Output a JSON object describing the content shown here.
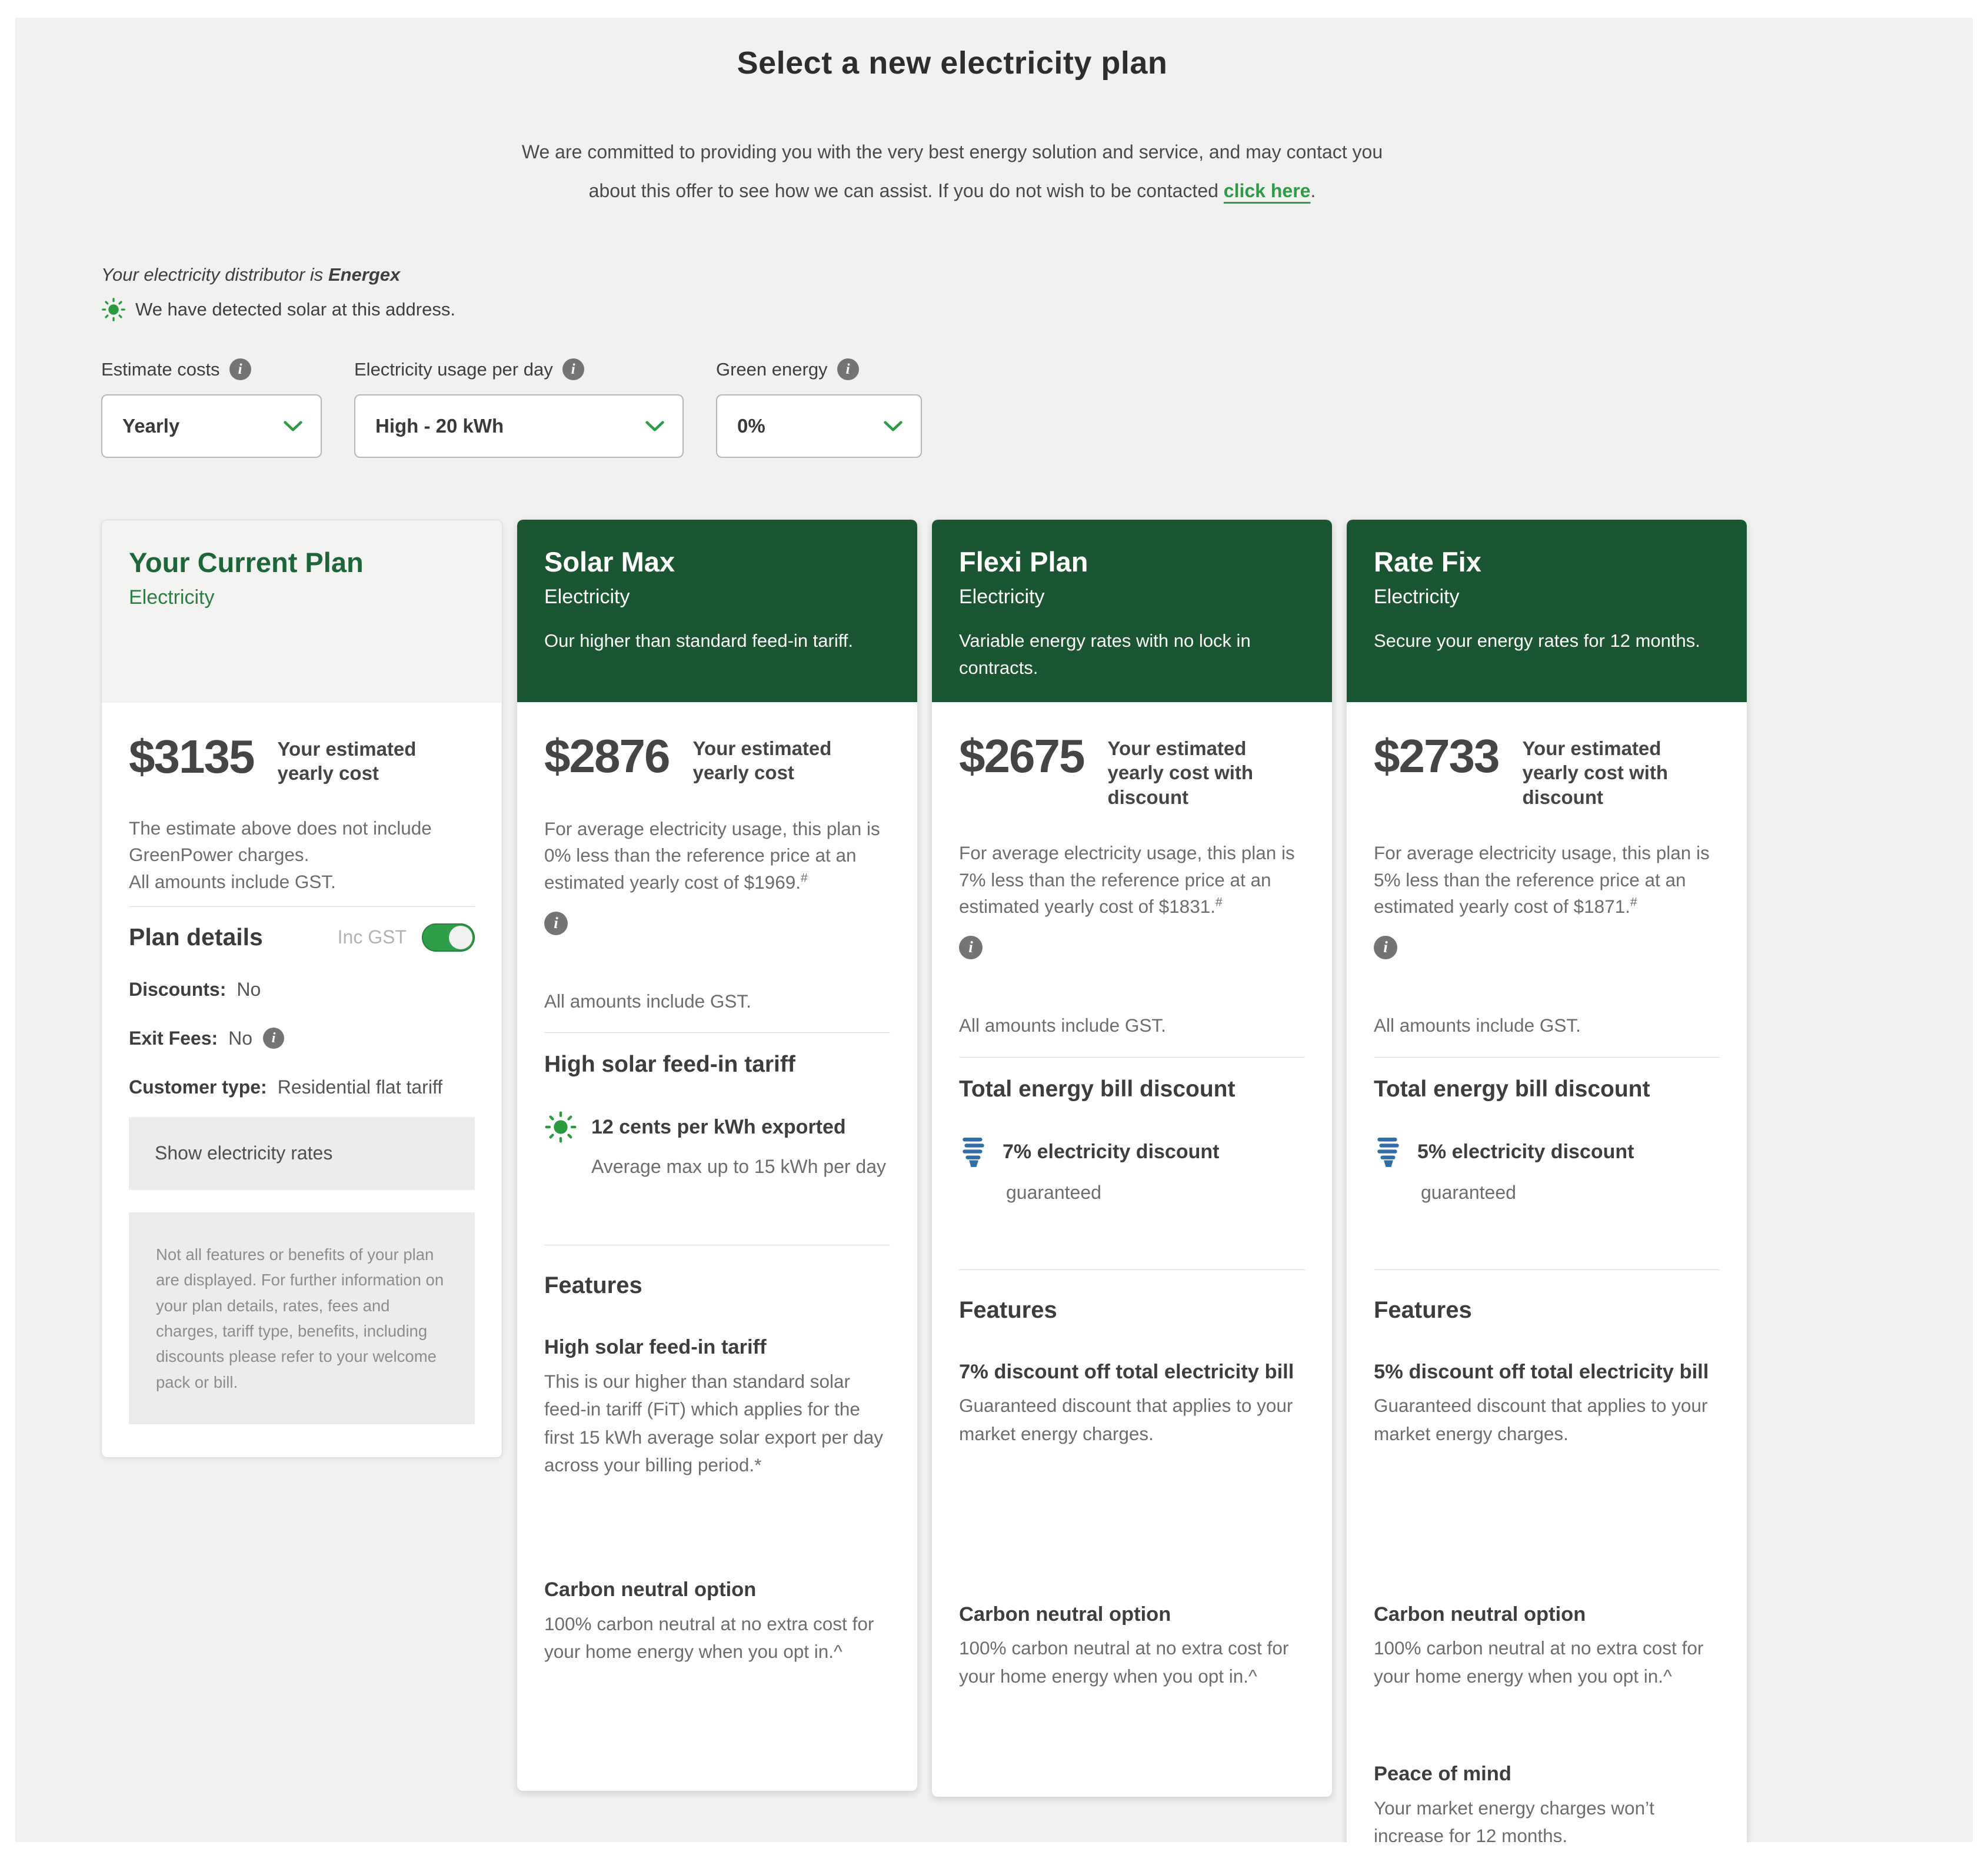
{
  "page": {
    "title": "Select a new electricity plan",
    "intro": {
      "line1": "We are committed to providing you with the very best energy solution and service, and may contact you",
      "line2_before": "about this offer to see how we can assist. If you do not wish to be contacted",
      "link_text": "click here",
      "line2_after": "."
    },
    "distributor": {
      "prefix": "Your electricity distributor is",
      "name": "Energex",
      "solar_note": "We have detected solar at this address."
    },
    "colors": {
      "header_green": "#1b5633",
      "accent_green": "#2e9b45",
      "link_green": "#2f9a47",
      "bulb_blue": "#2f6ea6",
      "page_background": "#f1f1ef"
    }
  },
  "icons": {
    "info_glyph": "i"
  },
  "filters": [
    {
      "label": "Estimate costs",
      "value": "Yearly"
    },
    {
      "label": "Electricity usage per day",
      "value": "High - 20 kWh"
    },
    {
      "label": "Green energy",
      "value": "0%"
    }
  ],
  "cards": {
    "current": {
      "title": "Your Current Plan",
      "product": "Electricity",
      "price": "$3135",
      "price_label": "Your estimated yearly cost",
      "note_line1": "The estimate above does not include GreenPower charges.",
      "note_line2": "All amounts include GST.",
      "plan_details_label": "Plan details",
      "inc_gst_label": "Inc GST",
      "rows": [
        {
          "label": "Discounts:",
          "value": "No"
        },
        {
          "label": "Exit Fees:",
          "value": "No"
        },
        {
          "label": "Customer type:",
          "value": "Residential flat tariff"
        }
      ],
      "show_rates_label": "Show electricity rates",
      "disclaimer": "Not all features or benefits of your plan are displayed. For further information on your plan details, rates, fees and charges, tariff type, benefits, including discounts please refer to your welcome pack or bill."
    },
    "solar": {
      "title": "Solar Max",
      "product": "Electricity",
      "tagline": "Our higher than standard feed-in tariff.",
      "price": "$2876",
      "price_label": "Your estimated yearly cost",
      "reference_text": "For average electricity usage, this plan is 0% less than the reference price at an estimated yearly cost of $1969.",
      "reference_sup": "#",
      "gst_note": "All amounts include GST.",
      "benefit_heading": "High solar feed-in tariff",
      "benefit_title": "12 cents per kWh exported",
      "benefit_sub": "Average max up to 15 kWh per day",
      "features_heading": "Features",
      "features": [
        {
          "title": "High solar feed-in tariff",
          "text": "This is our higher than standard solar feed-in tariff (FiT) which applies for the first 15 kWh average solar export per day across your billing period.*"
        },
        {
          "title": "Carbon neutral option",
          "text": "100% carbon neutral at no extra cost for your home energy when you opt in.^"
        }
      ]
    },
    "flexi": {
      "title": "Flexi Plan",
      "product": "Electricity",
      "tagline": "Variable energy rates with no lock in contracts.",
      "price": "$2675",
      "price_label": "Your estimated yearly cost with discount",
      "reference_text": "For average electricity usage, this plan is 7% less than the reference price at an estimated yearly cost of $1831.",
      "reference_sup": "#",
      "gst_note": "All amounts include GST.",
      "benefit_heading": "Total energy bill discount",
      "benefit_title": "7% electricity discount",
      "benefit_sub": "guaranteed",
      "features_heading": "Features",
      "features": [
        {
          "title": "7% discount off total electricity bill",
          "text": "Guaranteed discount that applies to your market energy charges."
        },
        {
          "title": "Carbon neutral option",
          "text": "100% carbon neutral at no extra cost for your home energy when you opt in.^"
        }
      ]
    },
    "ratefix": {
      "title": "Rate Fix",
      "product": "Electricity",
      "tagline": "Secure your energy rates for 12 months.",
      "price": "$2733",
      "price_label": "Your estimated yearly cost with discount",
      "reference_text": "For average electricity usage, this plan is 5% less than the reference price at an estimated yearly cost of $1871.",
      "reference_sup": "#",
      "gst_note": "All amounts include GST.",
      "benefit_heading": "Total energy bill discount",
      "benefit_title": "5% electricity discount",
      "benefit_sub": "guaranteed",
      "features_heading": "Features",
      "features": [
        {
          "title": "5% discount off total electricity bill",
          "text": "Guaranteed discount that applies to your market energy charges."
        },
        {
          "title": "Carbon neutral option",
          "text": "100% carbon neutral at no extra cost for your home energy when you opt in.^"
        },
        {
          "title": "Peace of mind",
          "text": "Your market energy charges won’t increase for 12 months."
        }
      ]
    }
  }
}
